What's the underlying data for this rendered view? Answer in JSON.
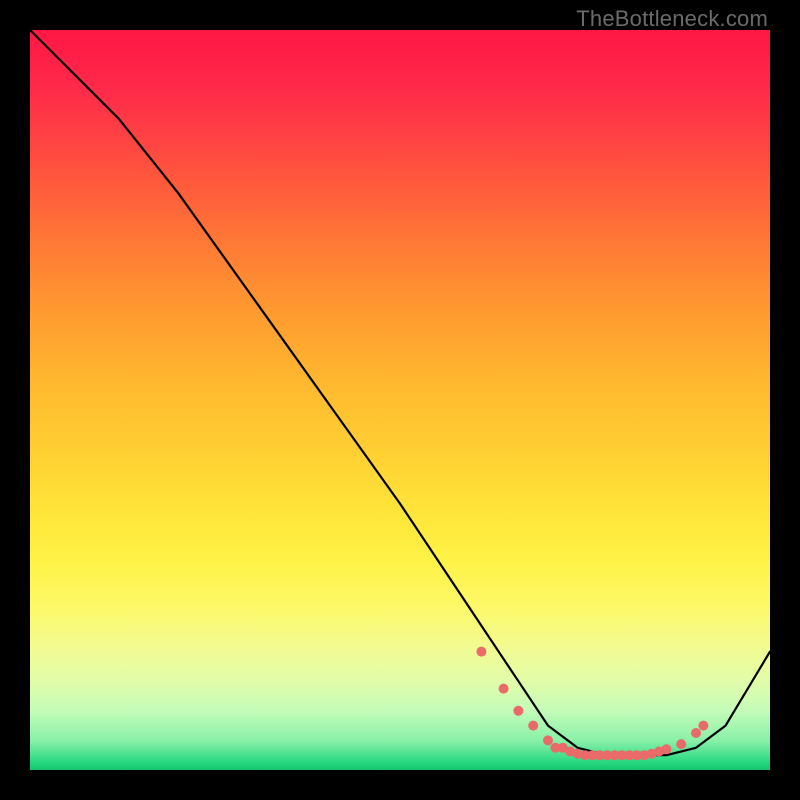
{
  "watermark": "TheBottleneck.com",
  "chart_data": {
    "type": "line",
    "title": "",
    "xlabel": "",
    "ylabel": "",
    "xlim": [
      0,
      100
    ],
    "ylim": [
      0,
      100
    ],
    "series": [
      {
        "name": "curve",
        "x": [
          0,
          4,
          8,
          12,
          20,
          30,
          40,
          50,
          58,
          62,
          66,
          70,
          74,
          78,
          82,
          86,
          90,
          94,
          100
        ],
        "y": [
          100,
          96,
          92,
          88,
          78,
          64,
          50,
          36,
          24,
          18,
          12,
          6,
          3,
          2,
          2,
          2,
          3,
          6,
          16
        ]
      }
    ],
    "markers": {
      "name": "dots",
      "color": "#ea6a6a",
      "x": [
        61,
        64,
        66,
        68,
        70,
        71,
        72,
        73,
        74,
        75,
        76,
        77,
        78,
        79,
        80,
        81,
        82,
        83,
        84,
        85,
        86,
        88,
        90,
        91
      ],
      "y": [
        16,
        11,
        8,
        6,
        4,
        3,
        3,
        2.5,
        2.2,
        2,
        2,
        2,
        2,
        2,
        2,
        2,
        2,
        2,
        2.2,
        2.5,
        2.8,
        3.5,
        5,
        6
      ]
    }
  }
}
